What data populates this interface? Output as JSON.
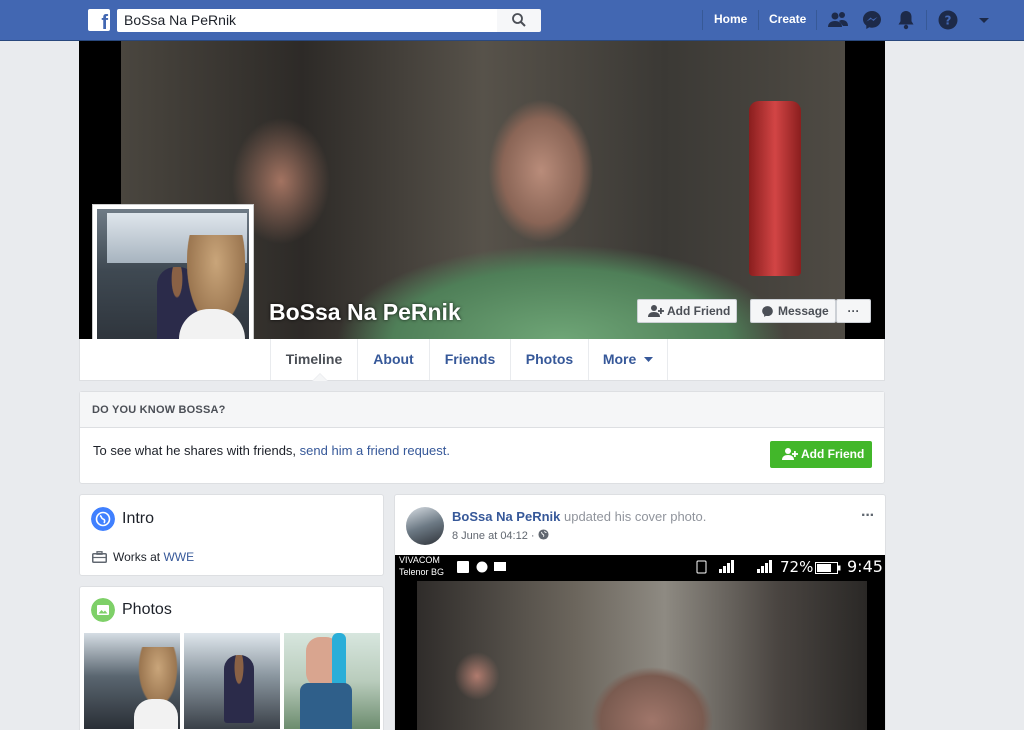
{
  "header": {
    "search_value": "BoSsa Na PeRnik",
    "nav": {
      "home": "Home",
      "create": "Create"
    },
    "brand_color": "#4267b2"
  },
  "profile": {
    "name": "BoSsa Na PeRnik",
    "add_friend_label": "Add Friend",
    "message_label": "Message",
    "more_dots": "···"
  },
  "tabs": [
    {
      "label": "Timeline"
    },
    {
      "label": "About"
    },
    {
      "label": "Friends"
    },
    {
      "label": "Photos"
    },
    {
      "label": "More"
    }
  ],
  "know_box": {
    "heading": "DO YOU KNOW BOSSA?",
    "text_prefix": "To see what he shares with friends, ",
    "link": "send him a friend request.",
    "button": "Add Friend"
  },
  "intro": {
    "title": "Intro",
    "works_at_prefix": "Works at ",
    "employer": "WWE"
  },
  "photos": {
    "title": "Photos"
  },
  "post": {
    "author": "BoSsa Na PeRnik",
    "action": " updated his cover photo.",
    "time": "8 June at 04:12 · ",
    "menu": "···",
    "status_carrier1": "VIVACOM",
    "status_carrier2": "Telenor BG",
    "status_battery": "72%",
    "status_time": "9:45"
  },
  "colors": {
    "link": "#365899",
    "green_button": "#42b72a"
  }
}
